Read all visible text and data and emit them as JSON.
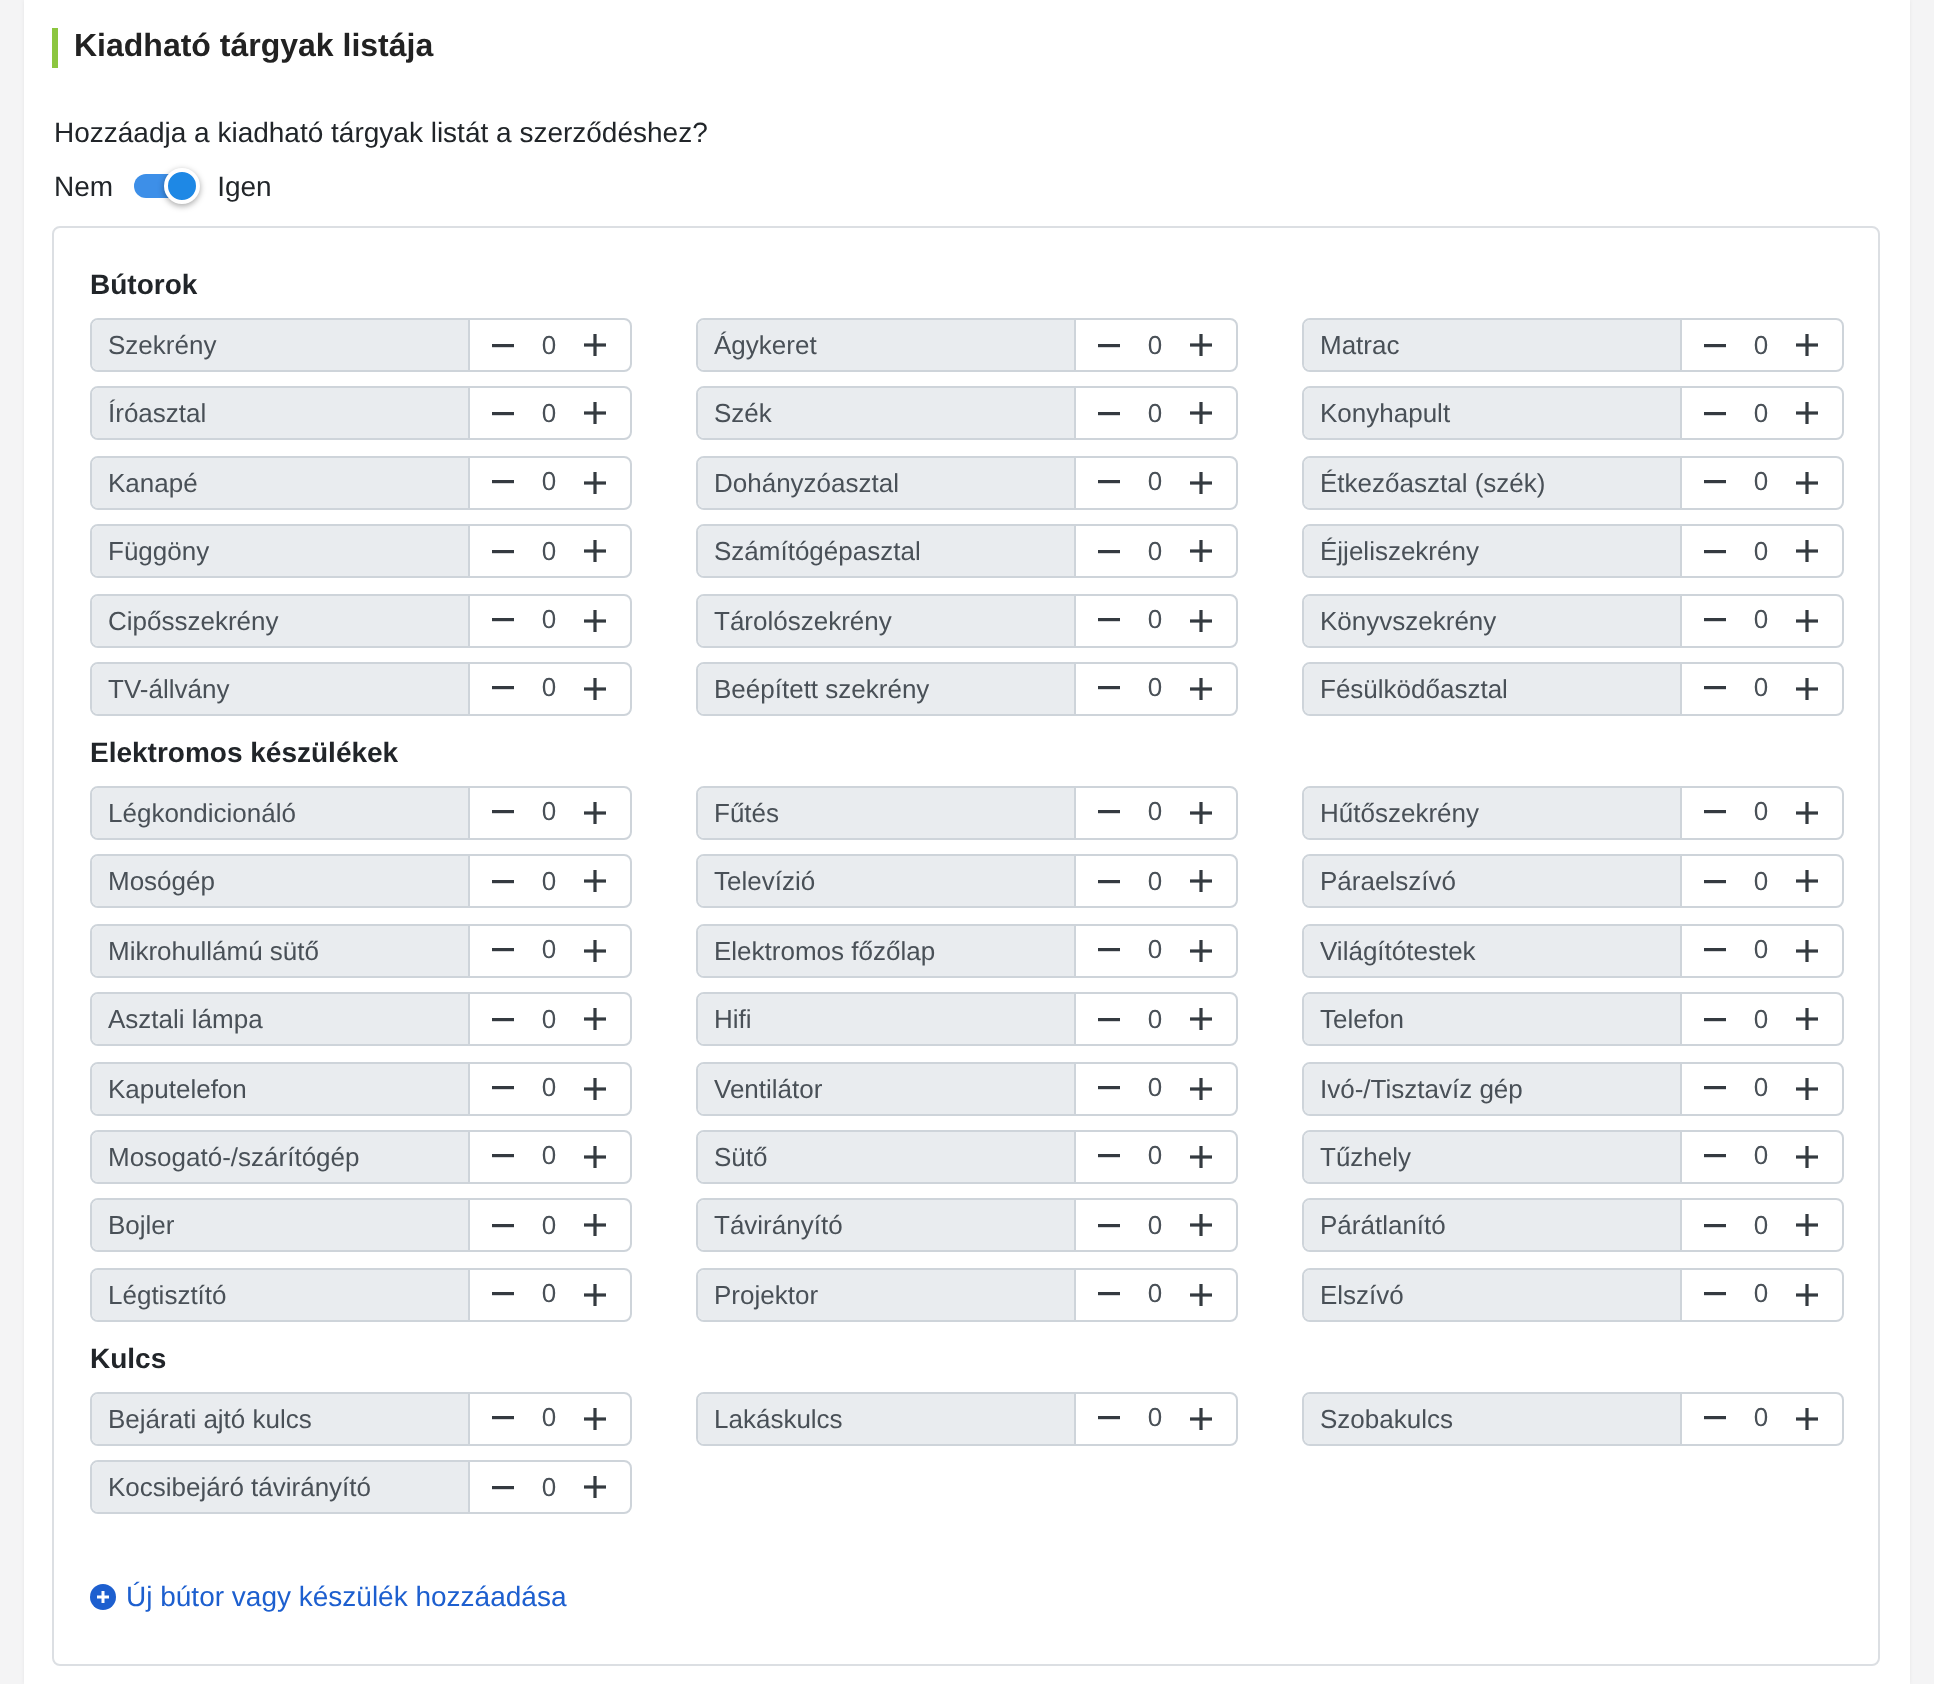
{
  "section": {
    "title": "Kiadható tárgyak listája"
  },
  "question": "Hozzáadja a kiadható tárgyak listát a szerződéshez?",
  "toggle": {
    "off_label": "Nem",
    "on_label": "Igen",
    "on": true
  },
  "groups": [
    {
      "title": "Bútorok",
      "items": [
        {
          "label": "Szekrény",
          "value": "0"
        },
        {
          "label": "Ágykeret",
          "value": "0"
        },
        {
          "label": "Matrac",
          "value": "0"
        },
        {
          "label": "Íróasztal",
          "value": "0"
        },
        {
          "label": "Szék",
          "value": "0"
        },
        {
          "label": "Konyhapult",
          "value": "0"
        },
        {
          "label": "Kanapé",
          "value": "0"
        },
        {
          "label": "Dohányzóasztal",
          "value": "0"
        },
        {
          "label": "Étkezőasztal (szék)",
          "value": "0"
        },
        {
          "label": "Függöny",
          "value": "0"
        },
        {
          "label": "Számítógépasztal",
          "value": "0"
        },
        {
          "label": "Éjjeliszekrény",
          "value": "0"
        },
        {
          "label": "Cipősszekrény",
          "value": "0"
        },
        {
          "label": "Tárolószekrény",
          "value": "0"
        },
        {
          "label": "Könyvszekrény",
          "value": "0"
        },
        {
          "label": "TV-állvány",
          "value": "0"
        },
        {
          "label": "Beépített szekrény",
          "value": "0"
        },
        {
          "label": "Fésülködőasztal",
          "value": "0"
        }
      ]
    },
    {
      "title": "Elektromos készülékek",
      "items": [
        {
          "label": "Légkondicionáló",
          "value": "0"
        },
        {
          "label": "Fűtés",
          "value": "0"
        },
        {
          "label": "Hűtőszekrény",
          "value": "0"
        },
        {
          "label": "Mosógép",
          "value": "0"
        },
        {
          "label": "Televízió",
          "value": "0"
        },
        {
          "label": "Páraelszívó",
          "value": "0"
        },
        {
          "label": "Mikrohullámú sütő",
          "value": "0"
        },
        {
          "label": "Elektromos főzőlap",
          "value": "0"
        },
        {
          "label": "Világítótestek",
          "value": "0"
        },
        {
          "label": "Asztali lámpa",
          "value": "0"
        },
        {
          "label": "Hifi",
          "value": "0"
        },
        {
          "label": "Telefon",
          "value": "0"
        },
        {
          "label": "Kaputelefon",
          "value": "0"
        },
        {
          "label": "Ventilátor",
          "value": "0"
        },
        {
          "label": "Ivó-/Tisztavíz gép",
          "value": "0"
        },
        {
          "label": "Mosogató-/szárítógép",
          "value": "0"
        },
        {
          "label": "Sütő",
          "value": "0"
        },
        {
          "label": "Tűzhely",
          "value": "0"
        },
        {
          "label": "Bojler",
          "value": "0"
        },
        {
          "label": "Távirányító",
          "value": "0"
        },
        {
          "label": "Párátlanító",
          "value": "0"
        },
        {
          "label": "Légtisztító",
          "value": "0"
        },
        {
          "label": "Projektor",
          "value": "0"
        },
        {
          "label": "Elszívó",
          "value": "0"
        }
      ]
    },
    {
      "title": "Kulcs",
      "items": [
        {
          "label": "Bejárati ajtó kulcs",
          "value": "0"
        },
        {
          "label": "Lakáskulcs",
          "value": "0"
        },
        {
          "label": "Szobakulcs",
          "value": "0"
        },
        {
          "label": "Kocsibejáró távirányító",
          "value": "0"
        }
      ]
    }
  ],
  "add_link": "Új bútor vagy készülék hozzáadása"
}
